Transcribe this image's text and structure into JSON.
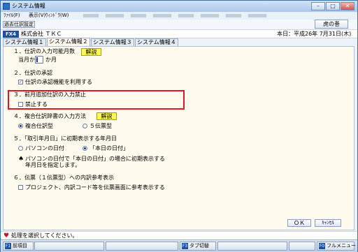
{
  "window": {
    "title": "システム情報",
    "minimize": "–",
    "maximize": "□",
    "close": "✕"
  },
  "menu": {
    "items": [
      "ﾌｧｲﾙ(F)",
      "表示(V)",
      "ｳｨﾝﾄﾞｳ(W)"
    ]
  },
  "toolbar": {
    "history_button": "過去仕訳設定",
    "toranomaki_button": "虎の巻"
  },
  "company_bar": {
    "fkey": "FX4",
    "company": "株式会社 ＴＫＣ",
    "date": "本日：平成26年 7月31日(木)"
  },
  "tabs": [
    "システム情報１",
    "システム情報２",
    "システム情報３",
    "システム情報４"
  ],
  "section1": {
    "title": "１．仕訳の入力可能月数",
    "explain": "解説",
    "prefix": "当月から",
    "value": "",
    "suffix": "か月"
  },
  "section2": {
    "title": "２．仕訳の承認",
    "option": "仕訳の承認機能を利用する",
    "checked": true
  },
  "section3": {
    "title": "３．前月追加仕訳の入力禁止",
    "option": "禁止する",
    "checked": false,
    "highlight_color": "#e8141c"
  },
  "section4": {
    "title": "４．複合仕訳辞書の入力方法",
    "explain": "解説",
    "option1": "複合仕訳型",
    "option2": "５伝票型",
    "selected": "複合仕訳型"
  },
  "section5": {
    "title": "５．「取引年月日」に初期表示する年月日",
    "option1": "パソコンの日付",
    "option2": "「本日の日付」",
    "selected": "「本日の日付」",
    "note_line1": "パソコンの日付で「本日の日付」の場合に初期表示する",
    "note_line2": "年月日を指定します。"
  },
  "section6": {
    "title": "６．伝票（１伝票型）への内訳参考表示",
    "option": "プロジェクト、内訳コード等を伝票画面に参考表示する",
    "checked": false
  },
  "buttons": {
    "ok": "ＯＫ",
    "cancel": "ｷｬﾝｾﾙ"
  },
  "status": {
    "message": "処理を選択してください。"
  },
  "function_keys": [
    {
      "key": "F1",
      "label": "前項目"
    },
    {
      "key": "F3",
      "label": "タブ切替"
    },
    {
      "key": "F0",
      "label": "フルメニュー"
    }
  ]
}
